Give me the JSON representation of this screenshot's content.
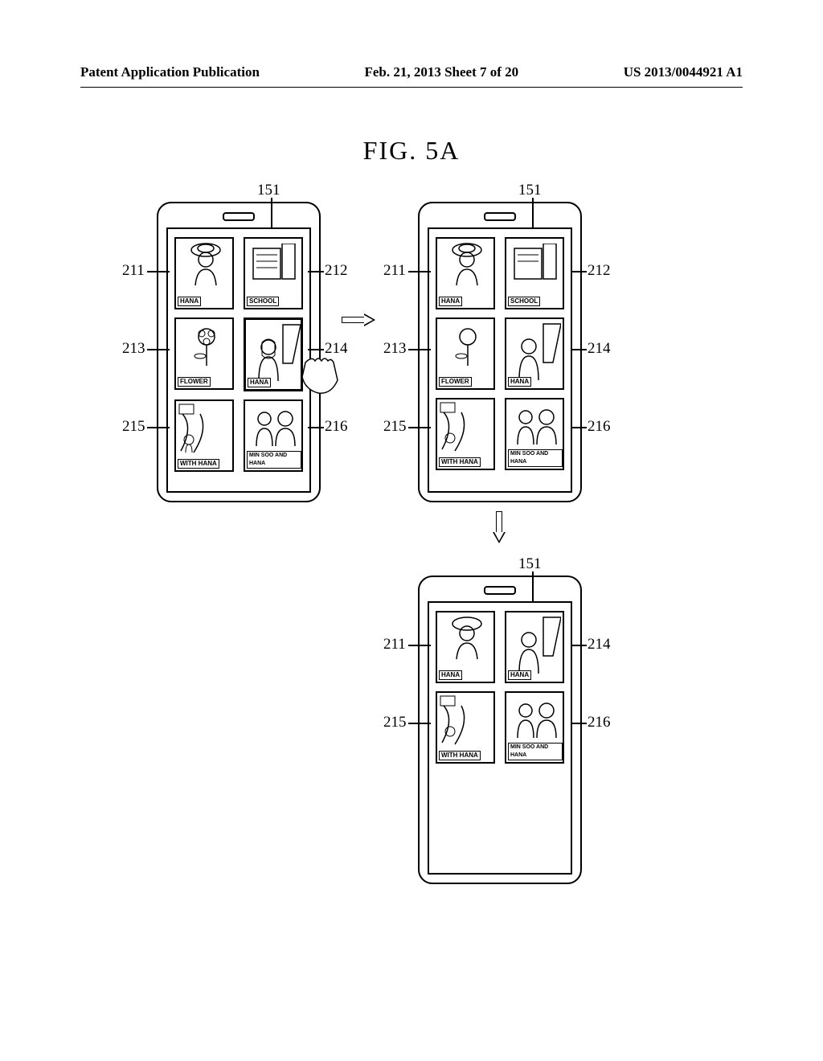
{
  "header": {
    "left": "Patent Application Publication",
    "center": "Feb. 21, 2013  Sheet 7 of 20",
    "right": "US 2013/0044921 A1"
  },
  "figure_title": "FIG.  5A",
  "labels": {
    "ref_151": "151",
    "ref_211": "211",
    "ref_212": "212",
    "ref_213": "213",
    "ref_214": "214",
    "ref_215": "215",
    "ref_216": "216"
  },
  "thumbs": {
    "hana": "HANA",
    "school": "SCHOOL",
    "flower": "FLOWER",
    "hana2": "HANA",
    "with_hana": "WITH HANA",
    "minsoo": "MIN SOO AND HANA"
  }
}
